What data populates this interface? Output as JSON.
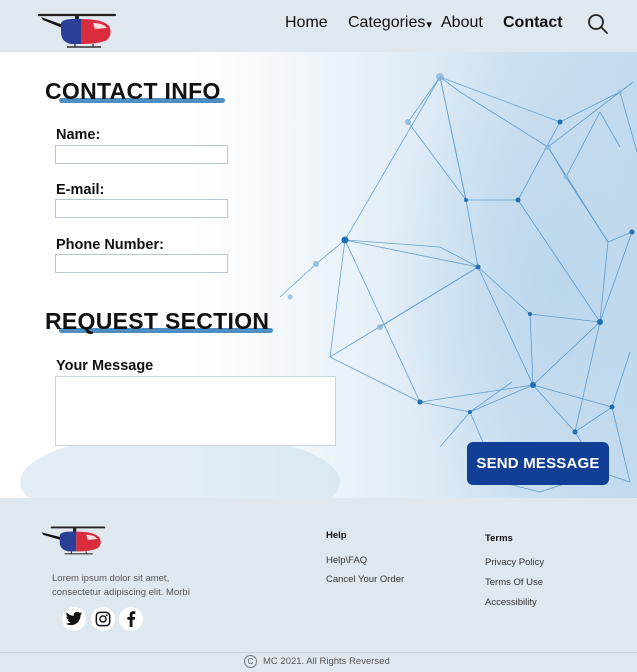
{
  "header": {
    "nav": {
      "home": "Home",
      "categories": "Categories",
      "categories_caret": "▾",
      "about": "About",
      "contact": "Contact"
    }
  },
  "contact": {
    "title": "CONTACT INFO",
    "name_label": "Name:",
    "name_value": "",
    "email_label": "E-mail:",
    "email_value": "",
    "phone_label": "Phone Number:",
    "phone_value": ""
  },
  "request": {
    "title": "REQUEST SECTION",
    "message_label": "Your Message",
    "message_value": "",
    "send_label": "SEND MESSAGE"
  },
  "footer": {
    "description": "Lorem ipsum dolor sit amet, consectetur adipiscing elit. Morbi",
    "social_icons": [
      "twitter-icon",
      "instagram-icon",
      "facebook-icon"
    ],
    "help": {
      "heading": "Help",
      "links": [
        "Help\\FAQ",
        "Cancel Your Order"
      ]
    },
    "terms": {
      "heading": "Terms",
      "links": [
        "Privacy Policy",
        "Terms Of Use",
        "Accessibility"
      ]
    },
    "copyright_symbol": "C",
    "copyright": "MC 2021. All Rights Reversed"
  },
  "colors": {
    "accent": "#123f96",
    "title_underline": "#4e8fc3",
    "background": "#dfe8ef"
  }
}
